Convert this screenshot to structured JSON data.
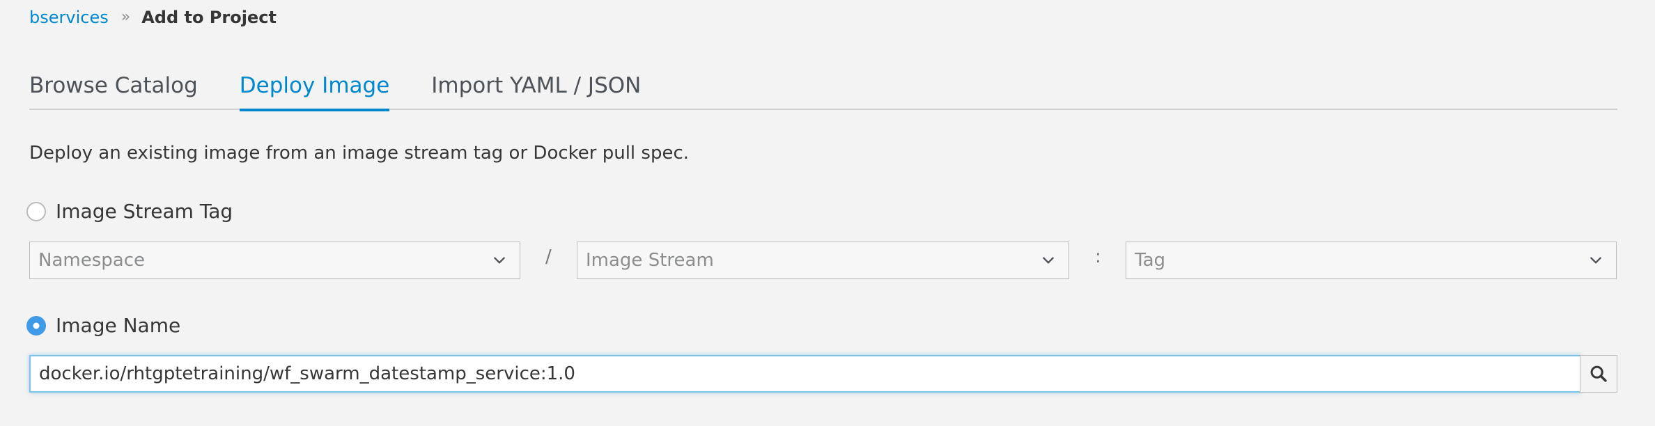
{
  "breadcrumb": {
    "parent": "bservices",
    "separator": "»",
    "current": "Add to Project"
  },
  "tabs": [
    {
      "label": "Browse Catalog",
      "active": false
    },
    {
      "label": "Deploy Image",
      "active": true
    },
    {
      "label": "Import YAML / JSON",
      "active": false
    }
  ],
  "description": "Deploy an existing image from an image stream tag or Docker pull spec.",
  "image_stream_tag": {
    "label": "Image Stream Tag",
    "checked": false,
    "namespace_placeholder": "Namespace",
    "slash": "/",
    "image_stream_placeholder": "Image Stream",
    "colon": ":",
    "tag_placeholder": "Tag"
  },
  "image_name": {
    "label": "Image Name",
    "checked": true,
    "value": "docker.io/rhtgptetraining/wf_swarm_datestamp_service:1.0"
  },
  "colors": {
    "link": "#0088ce",
    "radio_checked": "#3f9ae8",
    "input_focus_border": "#7dc3e8"
  },
  "icons": {
    "select_chevron": "chevron-down-icon",
    "search_button": "search-icon"
  }
}
